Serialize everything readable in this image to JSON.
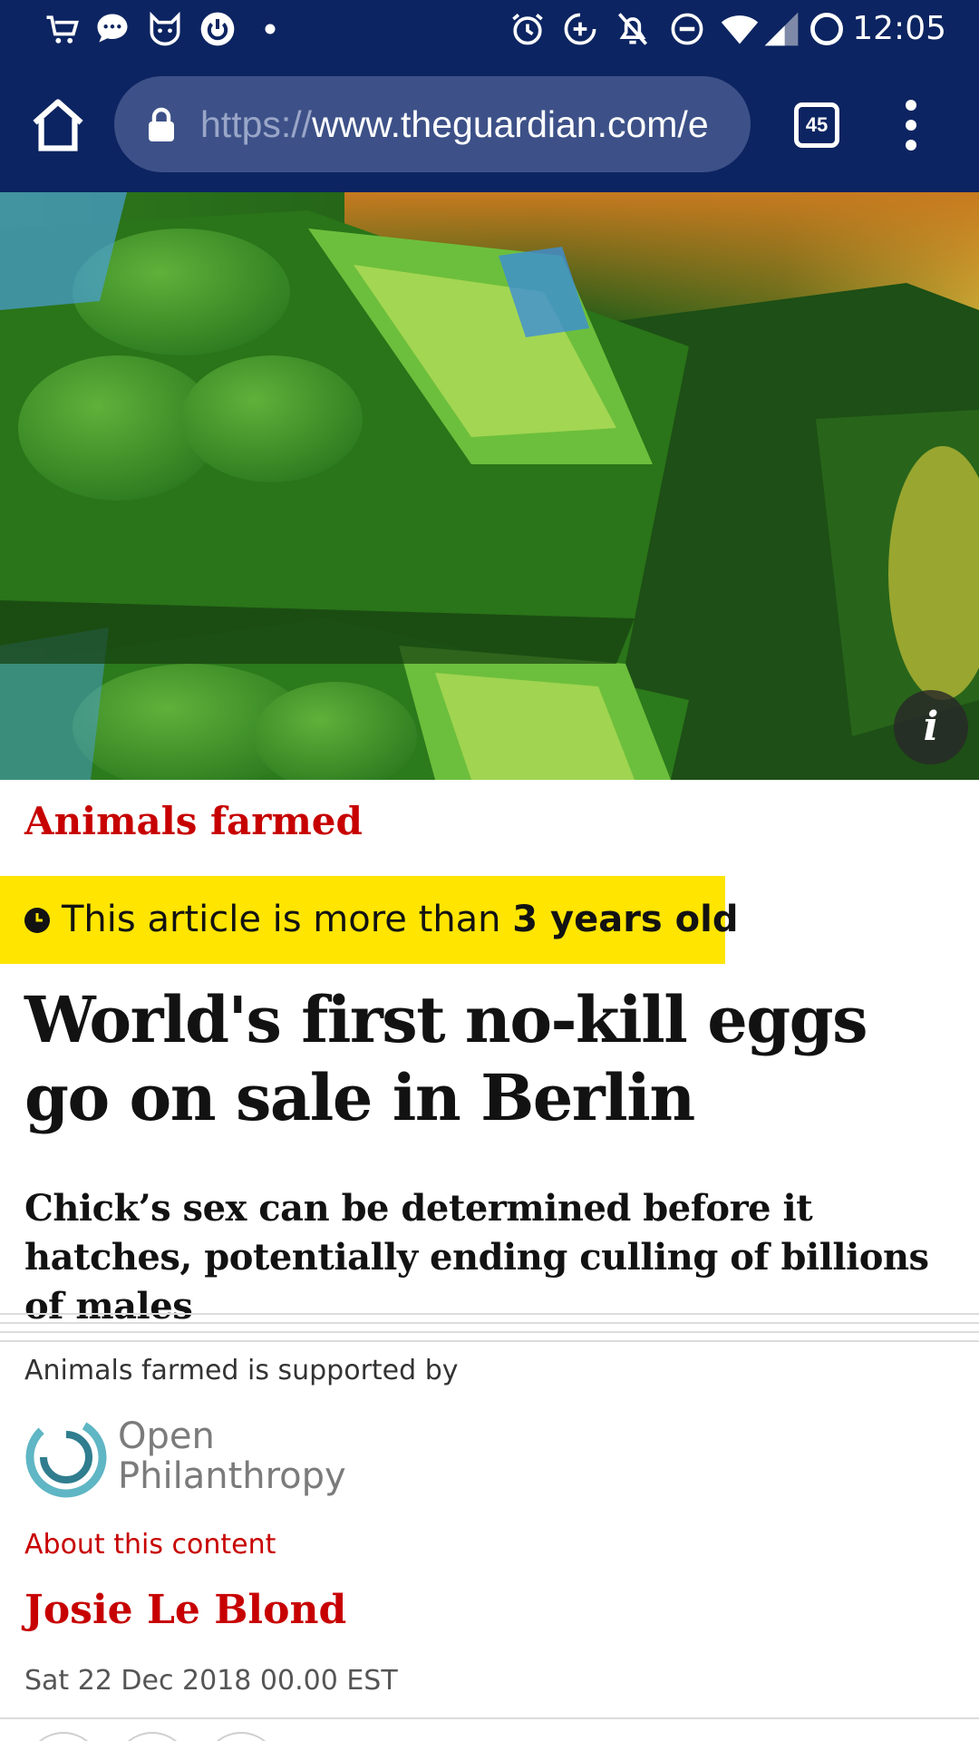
{
  "status_bar": {
    "time": "12:05",
    "icons": [
      "shopping-cart-icon",
      "chat-bubble-icon",
      "cat-app-icon",
      "power-app-icon",
      "notification-dot-icon",
      "alarm-icon",
      "data-saver-icon",
      "notifications-off-icon",
      "do-not-disturb-icon",
      "wifi-icon",
      "cellular-signal-icon",
      "sync-icon"
    ]
  },
  "browser": {
    "url_scheme": "https://",
    "url_host": "www.theguardian.com/e",
    "tab_count": "45",
    "toolbar_color": "#0c2461"
  },
  "hero": {
    "info_label": "i"
  },
  "article": {
    "section": "Animals farmed",
    "age_notice_prefix": "This article is more than ",
    "age_notice_emphasis": "3 years old",
    "headline": "World's first no-kill eggs go on sale in Berlin",
    "standfirst": "Chick’s sex can be determined before it hatches, potentially ending culling of billions of males",
    "supported_by": "Animals farmed is supported by",
    "sponsor_line1": "Open",
    "sponsor_line2": "Philanthropy",
    "about_link": "About this content",
    "author": "Josie Le Blond",
    "date": "Sat 22 Dec 2018 00.00 EST",
    "accent_color": "#c70000",
    "banner_color": "#ffe500"
  }
}
